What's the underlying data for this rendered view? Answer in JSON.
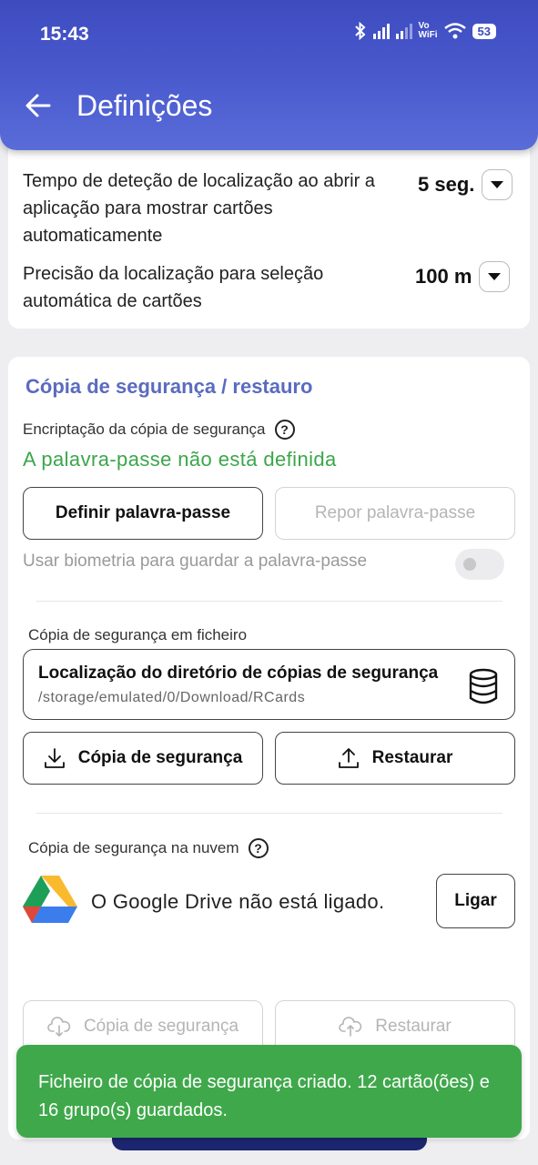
{
  "status_bar": {
    "time": "15:43",
    "vowifi_top": "Vo",
    "vowifi_bottom": "WiFi",
    "battery": "53"
  },
  "header": {
    "title": "Definições"
  },
  "location_card": {
    "detection_time": {
      "label": "Tempo de deteção de localização ao abrir a aplicação para mostrar cartões automaticamente",
      "value": "5 seg."
    },
    "precision": {
      "label": "Precisão da localização para seleção automática de cartões",
      "value": "100 m"
    }
  },
  "backup_card": {
    "title": "Cópia de segurança / restauro",
    "encryption_label": "Encriptação da cópia de segurança",
    "password_status": "A palavra-passe não está definida",
    "set_password_button": "Definir palavra-passe",
    "reset_password_button": "Repor palavra-passe",
    "biometrics_label": "Usar biometria para guardar a palavra-passe",
    "biometrics_enabled": false,
    "file_backup_label": "Cópia de segurança em ficheiro",
    "directory_title": "Localização do diretório de cópias de segurança",
    "directory_path": "/storage/emulated/0/Download/RCards",
    "backup_button": "Cópia de segurança",
    "restore_button": "Restaurar",
    "cloud_label": "Cópia de segurança na nuvem",
    "gdrive_status": "O Google Drive não está ligado.",
    "connect_button": "Ligar",
    "cloud_backup_button": "Cópia de segurança",
    "cloud_restore_button": "Restaurar"
  },
  "toast": {
    "message": "Ficheiro de cópia de segurança criado. 12 cartão(ões) e 16 grupo(s) guardados."
  },
  "colors": {
    "appbar": "#4c5dd0",
    "section_title": "#5b6bbf",
    "success": "#3fa84b"
  }
}
